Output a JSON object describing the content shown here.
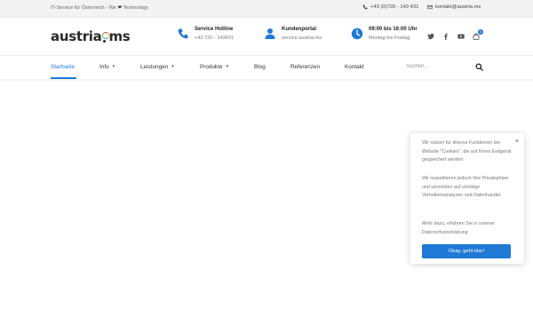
{
  "topbar": {
    "tagline_prefix": "IT-Service für Österreich - We",
    "tagline_suffix": "Technology",
    "heart_icon": "heart-icon",
    "phone": "+43 (0)720 - 143 431",
    "email": "kontakt@austria.ms"
  },
  "header": {
    "logo_left": "austria",
    "logo_right": "ms",
    "hotline": {
      "title": "Service Hotline",
      "sub": "+43 720 - 143431",
      "icon": "phone-icon"
    },
    "portal": {
      "title": "Kundenportal",
      "sub": "service.austria.ms",
      "icon": "user-icon"
    },
    "hours": {
      "title": "09:00 bis 16:00 Uhr",
      "sub": "Montag bis Freitag",
      "icon": "clock-icon"
    },
    "socials": [
      "twitter-icon",
      "facebook-icon",
      "youtube-icon"
    ],
    "cart_count": "0",
    "accent_color": "#1f79d5"
  },
  "nav": {
    "items": [
      {
        "label": "Startseite",
        "active": true
      },
      {
        "label": "Info",
        "dropdown": true
      },
      {
        "label": "Leistungen",
        "dropdown": true
      },
      {
        "label": "Produkte",
        "dropdown": true
      },
      {
        "label": "Blog"
      },
      {
        "label": "Referenzen"
      },
      {
        "label": "Kontakt"
      }
    ],
    "search_placeholder": "Suchen..."
  },
  "cookie": {
    "p1": "Wir nutzen für diverse Funktionen der Website \"Cookies\", die auf Ihrem Endgerät gespeichert werden.",
    "p2": "Wir respektieren jedoch Ihre Privatsphäre und verzichten auf unnötige Verhaltensanalysen und Datenhandel.",
    "p3": "Mehr dazu, erfahren Sie in unserer Datenschutzerklärung",
    "button": "Okay, geht klar!",
    "close": "×"
  }
}
